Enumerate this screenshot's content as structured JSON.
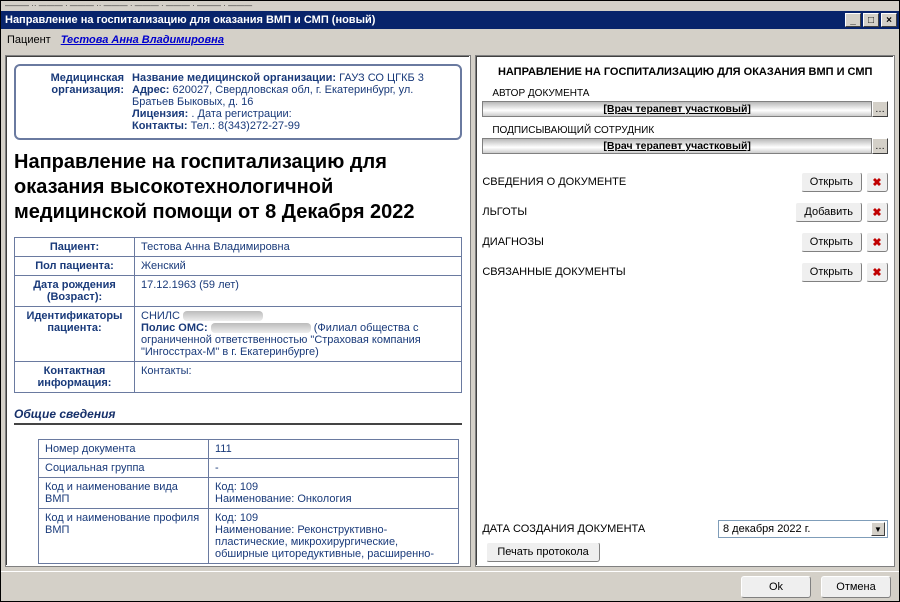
{
  "window": {
    "title": "Направление на госпитализацию для оказания ВМП и СМП (новый)",
    "min": "_",
    "max": "□",
    "close": "×"
  },
  "patientbar": {
    "label": "Пациент",
    "name": "Тестова Анна Владимировна"
  },
  "org": {
    "label": "Медицинская организация:",
    "name_label": "Название медицинской организации:",
    "name": "ГАУЗ СО ЦГКБ 3",
    "addr_label": "Адрес:",
    "addr": "620027, Свердловская обл, г. Екатеринбург, ул. Братьев Быковых, д. 16",
    "lic_label": "Лицензия:",
    "lic": ". Дата регистрации:",
    "contacts_label": "Контакты:",
    "contacts": "Тел.: 8(343)272-27-99"
  },
  "doc_title": "Направление на госпитализацию для оказания высокотехнологичной медицинской помощи от 8 Декабря 2022",
  "pt": {
    "r1l": "Пациент:",
    "r1v": "Тестова Анна Владимировна",
    "r2l": "Пол пациента:",
    "r2v": "Женский",
    "r3l": "Дата рождения (Возраст):",
    "r3v": "17.12.1963 (59 лет)",
    "r4l": "Идентификаторы пациента:",
    "r4v_line1": "СНИЛС",
    "r4v_line2a": "Полис ОМС:",
    "r4v_line2b": "(Филиал общества с ограниченной ответственностью \"Страховая компания \"Ингосстрах-М\" в г. Екатеринбурге)",
    "r5l": "Контактная информация:",
    "r5v": "Контакты:"
  },
  "gen": {
    "header": "Общие сведения",
    "r1l": "Номер документа",
    "r1v": "111",
    "r2l": "Социальная группа",
    "r2v": "-",
    "r3l": "Код и наименование вида ВМП",
    "r3v": "Код: 109\nНаименование: Онкология",
    "r4l": "Код и наименование профиля ВМП",
    "r4v": "Код: 109\nНаименование: Реконструктивно-пластические, микрохирургические, обширные циторедуктивные, расширенно-"
  },
  "right": {
    "title": "НАПРАВЛЕНИЕ НА ГОСПИТАЛИЗАЦИЮ ДЛЯ ОКАЗАНИЯ ВМП И СМП",
    "author_label": "АВТОР ДОКУМЕНТА",
    "author_value": "[Врач терапевт участковый]",
    "signer_label": "ПОДПИСЫВАЮЩИЙ СОТРУДНИК",
    "signer_value": "[Врач терапевт участковый]",
    "rows": {
      "docinfo": "СВЕДЕНИЯ О ДОКУМЕНТЕ",
      "benefits": "ЛЬГОТЫ",
      "diagnoses": "ДИАГНОЗЫ",
      "linked": "СВЯЗАННЫЕ ДОКУМЕНТЫ"
    },
    "btn_open": "Открыть",
    "btn_add": "Добавить",
    "date_label": "ДАТА СОЗДАНИЯ ДОКУМЕНТА",
    "date_value": "8 декабря  2022 г.",
    "print_btn": "Печать протокола"
  },
  "footer": {
    "ok": "Ok",
    "cancel": "Отмена"
  }
}
